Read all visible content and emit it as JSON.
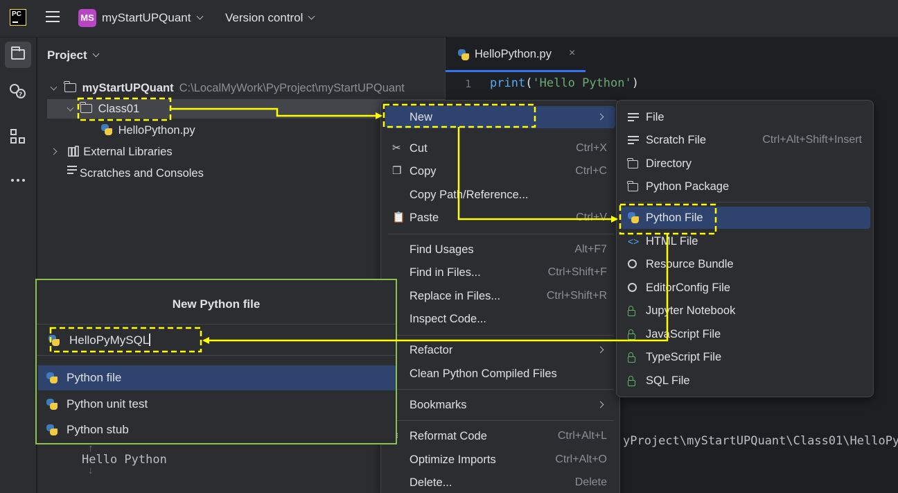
{
  "titlebar": {
    "logo_text": "PC",
    "project_badge": "MS",
    "project_name": "myStartUPQuant",
    "vcs_label": "Version control"
  },
  "project_panel": {
    "title": "Project",
    "tree": {
      "root_name": "myStartUPQuant",
      "root_path": "C:\\LocalMyWork\\PyProject\\myStartUPQuant",
      "folder": "Class01",
      "file": "HelloPython.py",
      "external_libraries": "External Libraries",
      "scratches": "Scratches and Consoles"
    }
  },
  "editor": {
    "tab_label": "HelloPython.py",
    "line_number": "1",
    "code": "print('Hello Python')",
    "run_path_fragment": "yProject\\myStartUPQuant\\Class01\\HelloPy",
    "console_output": "Hello Python"
  },
  "context_menu": {
    "new": "New",
    "cut": "Cut",
    "cut_shortcut": "Ctrl+X",
    "copy": "Copy",
    "copy_shortcut": "Ctrl+C",
    "copy_path": "Copy Path/Reference...",
    "paste": "Paste",
    "paste_shortcut": "Ctrl+V",
    "find_usages": "Find Usages",
    "find_usages_shortcut": "Alt+F7",
    "find_in_files": "Find in Files...",
    "find_in_files_shortcut": "Ctrl+Shift+F",
    "replace_in_files": "Replace in Files...",
    "replace_in_files_shortcut": "Ctrl+Shift+R",
    "inspect_code": "Inspect Code...",
    "refactor": "Refactor",
    "clean_compiled": "Clean Python Compiled Files",
    "bookmarks": "Bookmarks",
    "reformat_code": "Reformat Code",
    "reformat_shortcut": "Ctrl+Alt+L",
    "optimize_imports": "Optimize Imports",
    "optimize_shortcut": "Ctrl+Alt+O",
    "delete": "Delete...",
    "delete_shortcut": "Delete"
  },
  "new_submenu": {
    "file": "File",
    "scratch_file": "Scratch File",
    "scratch_shortcut": "Ctrl+Alt+Shift+Insert",
    "directory": "Directory",
    "python_package": "Python Package",
    "python_file": "Python File",
    "html_file": "HTML File",
    "resource_bundle": "Resource Bundle",
    "editorconfig_file": "EditorConfig File",
    "jupyter_notebook": "Jupyter Notebook",
    "javascript_file": "JavaScript File",
    "typescript_file": "TypeScript File",
    "sql_file": "SQL File"
  },
  "new_file_dialog": {
    "title": "New Python file",
    "input_value": "HelloPyMySQL",
    "options": [
      "Python file",
      "Python unit test",
      "Python stub"
    ]
  },
  "colors": {
    "accent": "#3574f0",
    "highlight": "#2e436e",
    "annotation_yellow": "#ffff00",
    "dialog_border": "#8bc34a",
    "string": "#6aab73",
    "keyword_print": "#56a8f5"
  }
}
